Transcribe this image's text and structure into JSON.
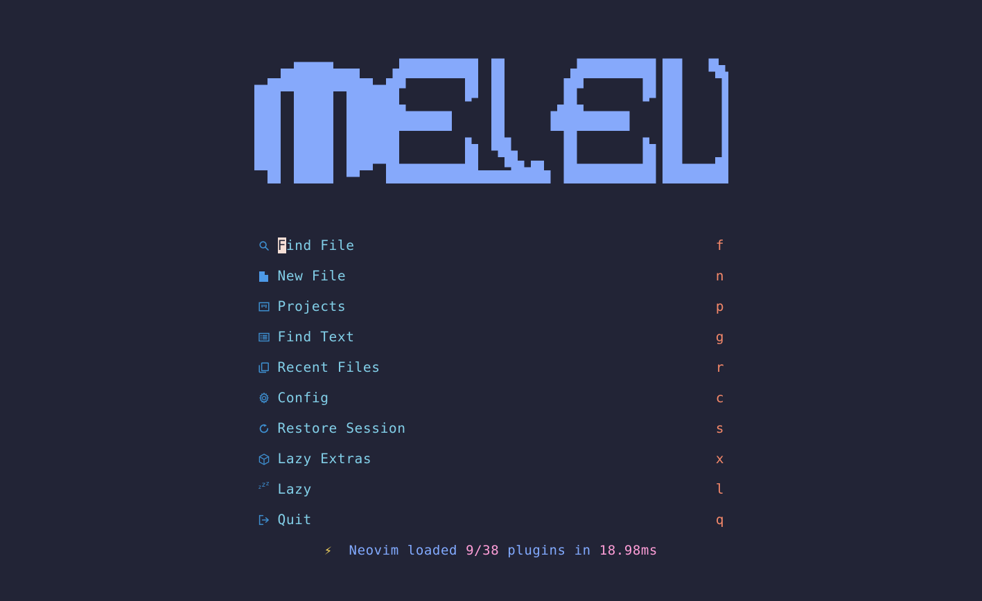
{
  "theme": {
    "background": "#222436",
    "logo_color": "#86a9fb",
    "label_color": "#82cfe8",
    "icon_color": "#3e8fd0",
    "shortcut_color": "#f4886a",
    "cursor_bg": "#f6dfd6",
    "footer_text_color": "#82aaff",
    "footer_number_color": "#ff9ed8",
    "bolt_color": "#f9d85e"
  },
  "logo": {
    "text": "MELEU",
    "style": "pixel-block-ascii-art"
  },
  "menu": {
    "items": [
      {
        "icon": "search-icon",
        "label": "Find File",
        "key": "f",
        "cursor_on_first_char": true
      },
      {
        "icon": "new-file-icon",
        "label": "New File",
        "key": "n",
        "cursor_on_first_char": false
      },
      {
        "icon": "projects-icon",
        "label": "Projects",
        "key": "p",
        "cursor_on_first_char": false
      },
      {
        "icon": "find-text-icon",
        "label": "Find Text",
        "key": "g",
        "cursor_on_first_char": false
      },
      {
        "icon": "recent-files-icon",
        "label": "Recent Files",
        "key": "r",
        "cursor_on_first_char": false
      },
      {
        "icon": "gear-icon",
        "label": "Config",
        "key": "c",
        "cursor_on_first_char": false
      },
      {
        "icon": "restore-icon",
        "label": "Restore Session",
        "key": "s",
        "cursor_on_first_char": false
      },
      {
        "icon": "package-icon",
        "label": "Lazy Extras",
        "key": "x",
        "cursor_on_first_char": false
      },
      {
        "icon": "sleep-zzz-icon",
        "label": "Lazy",
        "key": "l",
        "cursor_on_first_char": false
      },
      {
        "icon": "exit-icon",
        "label": "Quit",
        "key": "q",
        "cursor_on_first_char": false
      }
    ]
  },
  "footer": {
    "bolt_icon": "⚡",
    "prefix": "Neovim loaded ",
    "plugins_count": "9/38",
    "middle": " plugins in ",
    "load_time": "18.98ms"
  }
}
